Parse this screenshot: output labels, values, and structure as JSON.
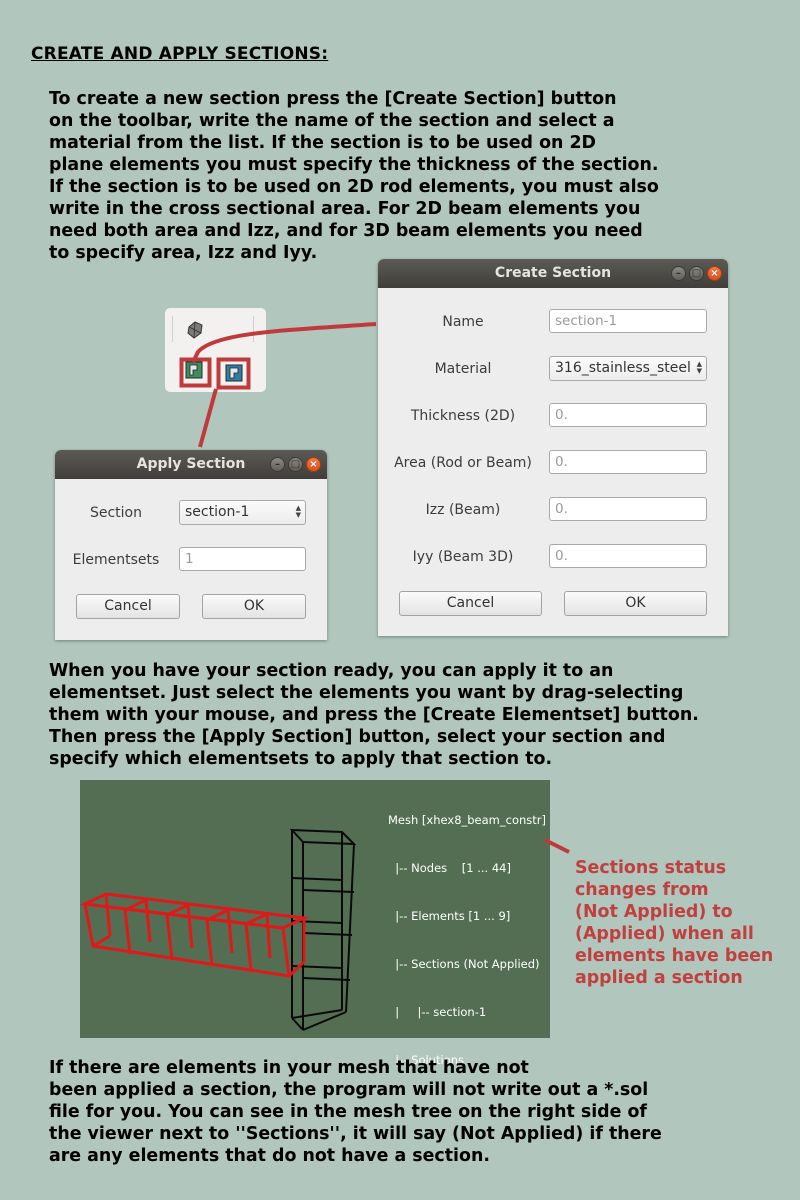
{
  "heading": "CREATE AND APPLY SECTIONS:",
  "paragraphs": {
    "intro": "To create a new section press the [Create Section] button\non the toolbar, write the name of the section and select a\nmaterial from the list. If the section is to be used on 2D\nplane elements you must specify the thickness of the section.\nIf the section is to be used on 2D rod elements, you must also\nwrite in the cross sectional area. For 2D beam elements you\nneed both area and Izz, and for 3D beam elements you need\nto specify area, Izz and Iyy.",
    "apply": "When you have your section ready, you can apply it to an\nelementset. Just select the elements you want by drag-selecting\nthem with your mouse, and press the [Create Elementset] button.\nThen press the [Apply Section] button, select your section and\nspecify which elementsets to apply that section to.",
    "outro": "If there are elements in your mesh that have not\nbeen applied a section, the program will not write out a *.sol\nfile for you. You can see in the mesh tree on the right side of\nthe viewer next to ''Sections'', it will say (Not Applied) if there\nare any elements that do not have a section."
  },
  "create_dialog": {
    "title": "Create Section",
    "name_label": "Name",
    "name_placeholder": "section-1",
    "material_label": "Material",
    "material_value": "316_stainless_steel",
    "thickness_label": "Thickness (2D)",
    "thickness_placeholder": "0.",
    "area_label": "Area (Rod or Beam)",
    "area_placeholder": "0.",
    "izz_label": "Izz (Beam)",
    "izz_placeholder": "0.",
    "iyy_label": "Iyy (Beam 3D)",
    "iyy_placeholder": "0.",
    "cancel_label": "Cancel",
    "ok_label": "OK"
  },
  "apply_dialog": {
    "title": "Apply Section",
    "section_label": "Section",
    "section_value": "section-1",
    "elementsets_label": "Elementsets",
    "elementsets_placeholder": "1",
    "cancel_label": "Cancel",
    "ok_label": "OK"
  },
  "toolbar_icons": [
    "mesh-icon",
    "create-section-icon",
    "apply-section-icon"
  ],
  "mesh_tree": {
    "root": "Mesh [xhex8_beam_constr]",
    "nodes": "  |-- Nodes    [1 ... 44]",
    "elements": "  |-- Elements [1 ... 9]",
    "sections": "  |-- Sections (Not Applied)",
    "section_child": "  |     |-- section-1",
    "solutions": "  |-- Solutions"
  },
  "callout": "Sections status\nchanges from\n(Not Applied) to\n(Applied) when all\nelements have been\napplied a section",
  "colors": {
    "background": "#b1c6bd",
    "highlight": "#c0403f",
    "viewer_bg": "#546e53",
    "selected_mesh": "#e01818"
  }
}
